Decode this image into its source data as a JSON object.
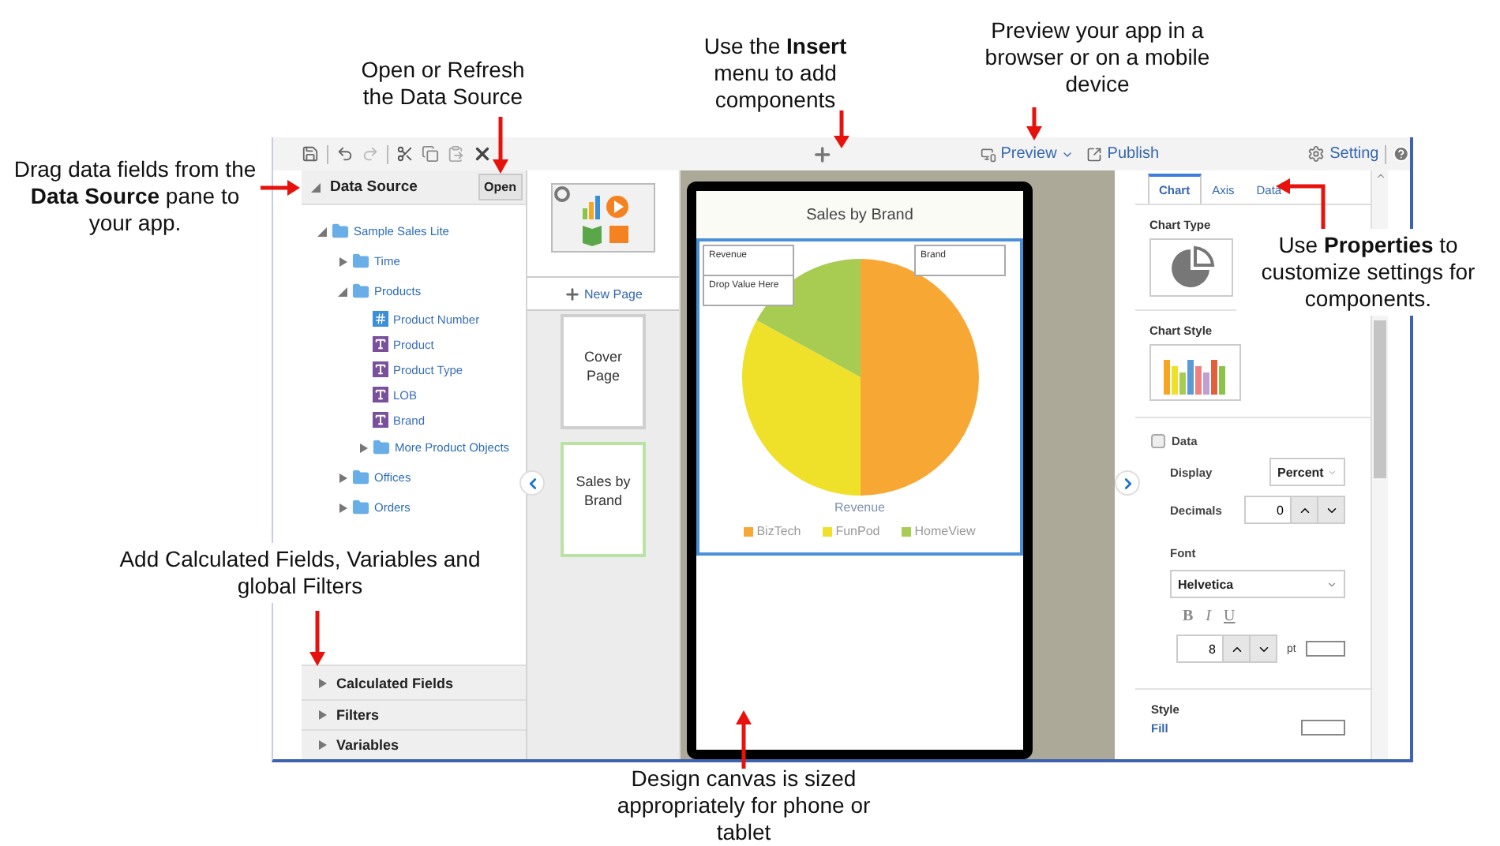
{
  "toolbar": {
    "preview": "Preview",
    "publish": "Publish",
    "setting": "Setting"
  },
  "data_source": {
    "title": "Data Source",
    "open_button": "Open",
    "tree": [
      {
        "label": "Sample Sales Lite",
        "kind": "folder",
        "expanded": true,
        "children": [
          {
            "label": "Time",
            "kind": "folder",
            "expanded": false
          },
          {
            "label": "Products",
            "kind": "folder",
            "expanded": true,
            "children": [
              {
                "label": "Product Number",
                "kind": "number"
              },
              {
                "label": "Product",
                "kind": "text"
              },
              {
                "label": "Product Type",
                "kind": "text"
              },
              {
                "label": "LOB",
                "kind": "text"
              },
              {
                "label": "Brand",
                "kind": "text"
              },
              {
                "label": "More Product Objects",
                "kind": "folder",
                "expanded": false
              }
            ]
          },
          {
            "label": "Offices",
            "kind": "folder",
            "expanded": false
          },
          {
            "label": "Orders",
            "kind": "folder",
            "expanded": false
          }
        ]
      }
    ],
    "sections": [
      {
        "label": "Calculated Fields",
        "expanded": false
      },
      {
        "label": "Filters",
        "expanded": false
      },
      {
        "label": "Variables",
        "expanded": false
      }
    ]
  },
  "pages": {
    "new_page": "New Page",
    "items": [
      {
        "label": "Cover Page",
        "selected": false
      },
      {
        "label": "Sales by Brand",
        "selected": true
      }
    ]
  },
  "canvas": {
    "page_title": "Sales by Brand",
    "drop_zones": [
      "Revenue",
      "Drop Value Here",
      "Brand"
    ],
    "axis_label": "Revenue",
    "legend": [
      {
        "label": "BizTech",
        "color": "#f7a834"
      },
      {
        "label": "FunPod",
        "color": "#efe02a"
      },
      {
        "label": "HomeView",
        "color": "#a8cc52"
      }
    ]
  },
  "properties": {
    "tabs": [
      {
        "label": "Chart",
        "selected": true
      },
      {
        "label": "Axis",
        "selected": false
      },
      {
        "label": "Data",
        "selected": false
      }
    ],
    "chart_type": "Chart Type",
    "chart_style": "Chart Style",
    "data_toggle": {
      "label": "Data",
      "checked": false
    },
    "display": {
      "label": "Display",
      "value": "Percent"
    },
    "decimals": {
      "label": "Decimals",
      "value": "0"
    },
    "font": {
      "label": "Font",
      "value": "Helvetica"
    },
    "format_buttons": [
      "B",
      "I",
      "U"
    ],
    "font_size": {
      "value": "8",
      "unit": "pt"
    },
    "style": "Style",
    "fill": "Fill"
  },
  "callouts": [
    {
      "text": "Drag data fields from the **Data Source** pane to your app."
    },
    {
      "text": "Open or Refresh the Data Source"
    },
    {
      "text": "Use the **Insert** menu to add components"
    },
    {
      "text": "Preview your app in a browser or on a mobile device"
    },
    {
      "text": "Use **Properties** to customize settings for components."
    },
    {
      "text": "Add Calculated Fields, Variables and global Filters"
    },
    {
      "text": "Design canvas is sized appropriately for phone or tablet"
    }
  ]
}
